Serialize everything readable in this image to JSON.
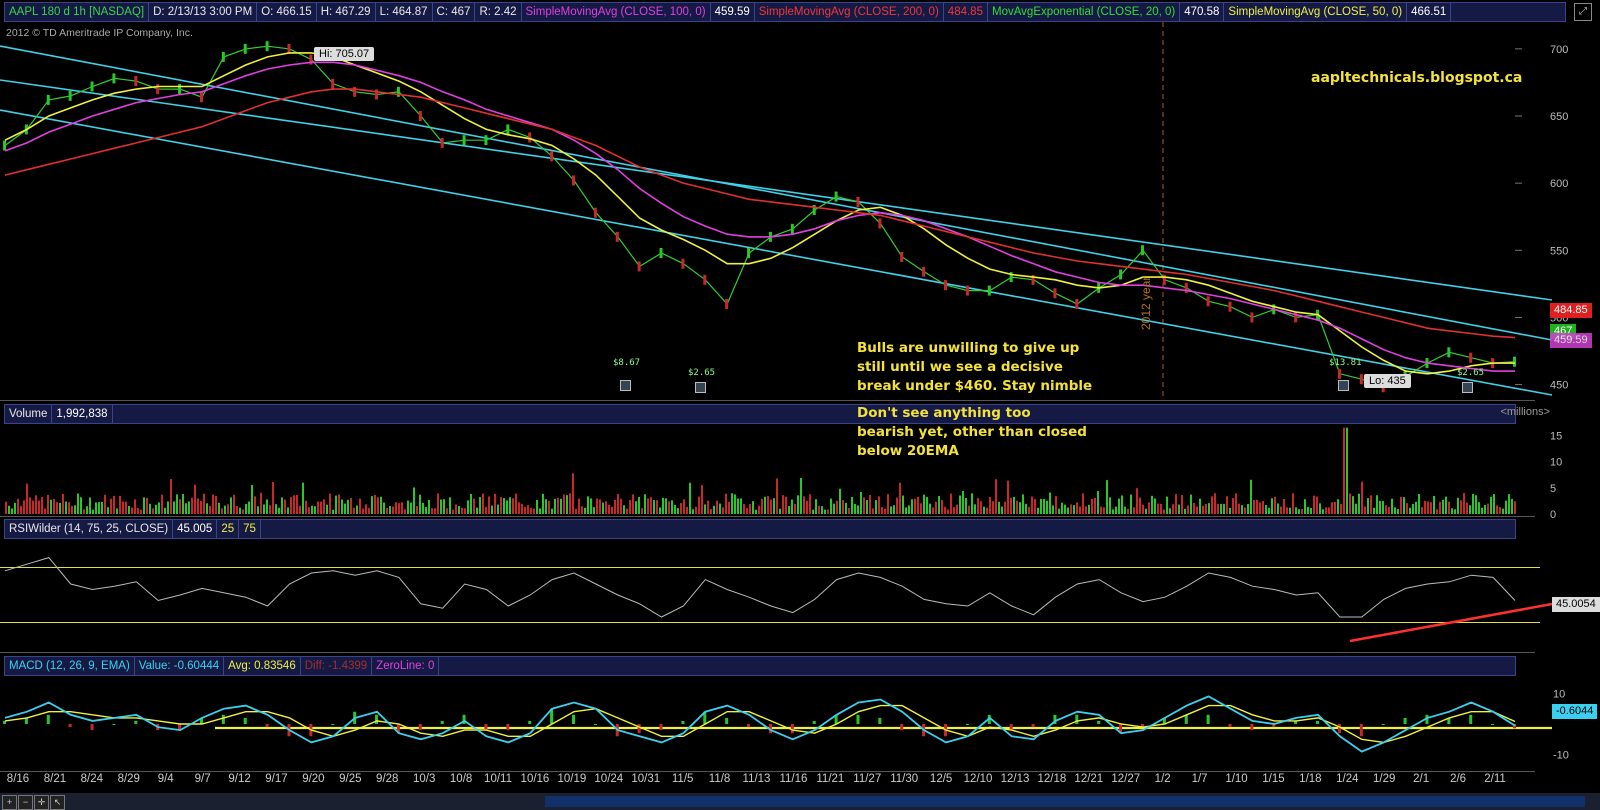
{
  "header": {
    "symbol": "AAPL 180 d 1h [NASDAQ]",
    "date": "D: 2/13/13 3:00 PM",
    "open": "O: 466.15",
    "high": "H: 467.29",
    "low": "L: 464.87",
    "close": "C: 467",
    "range": "R: 2.42",
    "studies": [
      {
        "label": "SimpleMovingAvg (CLOSE, 100, 0)",
        "value": "459.59",
        "color": "#e040e0"
      },
      {
        "label": "SimpleMovingAvg (CLOSE, 200, 0)",
        "value": "484.85",
        "color": "#e03030"
      },
      {
        "label": "MovAvgExponential (CLOSE, 20, 0)",
        "value": "470.58",
        "color": "#33dd33"
      },
      {
        "label": "SimpleMovingAvg (CLOSE, 50, 0)",
        "value": "466.51",
        "color": "#f0f040"
      }
    ]
  },
  "copyright": "2012 © TD Ameritrade IP Company, Inc.",
  "annotations": {
    "blog": "aapltechnicals.blogspot.ca",
    "bulls": "Bulls are unwilling to give up still until we see a decisive break under $460.  Stay nimble",
    "bearish": "Don't see anything too bearish yet, other than closed below 20EMA"
  },
  "callouts": {
    "hi": "Hi: 705.07",
    "lo": "Lo: 435",
    "year": "2012 year"
  },
  "events": [
    "$8.67",
    "$2.65",
    "$13.81",
    "$2.65"
  ],
  "price_tags": {
    "sma200": "484.85",
    "close": "467",
    "sma100": "459.59"
  },
  "volume": {
    "label": "Volume",
    "value": "1,992,838",
    "unit": "<millions>"
  },
  "rsi": {
    "label": "RSIWilder (14, 75, 25, CLOSE)",
    "value": "45.005",
    "ob": "25",
    "os": "75",
    "tag": "45.0054"
  },
  "macd": {
    "label": "MACD (12, 26, 9, EMA)",
    "value": "Value: -0.60444",
    "avg": "Avg: 0.83546",
    "diff": "Diff: -1.4399",
    "zero": "ZeroLine: 0",
    "tag": "-0.6044"
  },
  "chart_data": {
    "type": "line",
    "title": "AAPL 180 d 1h [NASDAQ]",
    "x_tick_labels": [
      "8/16",
      "8/21",
      "8/24",
      "8/29",
      "9/4",
      "9/7",
      "9/12",
      "9/17",
      "9/20",
      "9/25",
      "9/28",
      "10/3",
      "10/8",
      "10/11",
      "10/16",
      "10/19",
      "10/24",
      "10/31",
      "11/5",
      "11/8",
      "11/13",
      "11/16",
      "11/21",
      "11/27",
      "11/30",
      "12/5",
      "12/10",
      "12/13",
      "12/18",
      "12/21",
      "12/27",
      "1/2",
      "1/7",
      "1/10",
      "1/15",
      "1/18",
      "1/24",
      "1/29",
      "2/1",
      "2/6",
      "2/11"
    ],
    "price_axis": {
      "ticks": [
        450,
        500,
        550,
        600,
        650,
        700
      ],
      "ylim": [
        440,
        720
      ]
    },
    "series": [
      {
        "name": "Close",
        "color": "#33cc33",
        "values": [
          628,
          640,
          662,
          665,
          672,
          678,
          676,
          670,
          670,
          664,
          694,
          700,
          702,
          700,
          692,
          674,
          668,
          666,
          668,
          650,
          630,
          632,
          632,
          640,
          634,
          620,
          602,
          578,
          560,
          538,
          548,
          540,
          528,
          510,
          548,
          560,
          566,
          580,
          590,
          586,
          570,
          545,
          534,
          524,
          520,
          520,
          530,
          528,
          518,
          510,
          522,
          532,
          550,
          528,
          522,
          512,
          508,
          500,
          506,
          500,
          502,
          458,
          454,
          448,
          456,
          466,
          474,
          470,
          466,
          467
        ]
      },
      {
        "name": "SimpleMovingAvg (CLOSE, 50, 0)",
        "color": "#f0f040",
        "values": [
          632,
          640,
          650,
          656,
          662,
          667,
          670,
          672,
          672,
          672,
          680,
          688,
          694,
          697,
          697,
          694,
          688,
          682,
          676,
          668,
          658,
          648,
          640,
          636,
          633,
          628,
          618,
          606,
          590,
          574,
          565,
          558,
          550,
          540,
          540,
          544,
          552,
          562,
          572,
          580,
          582,
          576,
          566,
          554,
          544,
          536,
          532,
          530,
          528,
          524,
          522,
          524,
          530,
          530,
          528,
          524,
          518,
          512,
          508,
          504,
          502,
          490,
          478,
          468,
          460,
          458,
          460,
          464,
          466,
          466
        ]
      },
      {
        "name": "SimpleMovingAvg (CLOSE, 100, 0)",
        "color": "#e040e0",
        "values": [
          624,
          630,
          638,
          644,
          650,
          655,
          660,
          663,
          666,
          668,
          674,
          680,
          685,
          688,
          690,
          690,
          688,
          684,
          680,
          675,
          668,
          662,
          655,
          650,
          645,
          640,
          632,
          622,
          610,
          596,
          585,
          575,
          568,
          562,
          560,
          560,
          562,
          566,
          572,
          576,
          578,
          576,
          572,
          566,
          560,
          553,
          546,
          540,
          534,
          530,
          526,
          524,
          524,
          522,
          520,
          517,
          514,
          510,
          506,
          502,
          498,
          492,
          484,
          476,
          470,
          466,
          464,
          462,
          460,
          460
        ]
      },
      {
        "name": "SimpleMovingAvg (CLOSE, 200, 0)",
        "color": "#e03030",
        "values": [
          606,
          610,
          614,
          618,
          622,
          626,
          630,
          634,
          638,
          642,
          648,
          654,
          660,
          664,
          668,
          670,
          670,
          668,
          666,
          664,
          660,
          656,
          652,
          648,
          644,
          640,
          634,
          628,
          620,
          612,
          606,
          600,
          596,
          592,
          588,
          586,
          584,
          582,
          580,
          578,
          576,
          572,
          568,
          564,
          560,
          556,
          552,
          548,
          545,
          542,
          540,
          538,
          536,
          534,
          532,
          529,
          526,
          523,
          520,
          516,
          512,
          508,
          504,
          500,
          496,
          492,
          490,
          488,
          486,
          485
        ]
      }
    ],
    "volume_axis": {
      "ticks": [
        0,
        5,
        10,
        15
      ],
      "unit": "millions"
    },
    "rsi_axis": {
      "ticks": [
        25,
        75
      ]
    },
    "rsi_values": [
      72,
      78,
      84,
      60,
      55,
      58,
      62,
      45,
      50,
      56,
      52,
      48,
      40,
      60,
      70,
      72,
      68,
      72,
      66,
      42,
      38,
      60,
      55,
      40,
      50,
      64,
      70,
      60,
      50,
      42,
      30,
      40,
      64,
      55,
      48,
      40,
      34,
      46,
      64,
      70,
      66,
      58,
      46,
      42,
      40,
      52,
      40,
      32,
      48,
      60,
      64,
      52,
      44,
      48,
      58,
      70,
      66,
      58,
      55,
      50,
      52,
      30,
      30,
      46,
      56,
      60,
      62,
      68,
      66,
      45
    ],
    "macd_axis": {
      "ticks": [
        -10,
        10
      ]
    },
    "macd_values": [
      2,
      4,
      7,
      3,
      1,
      2,
      3,
      -1,
      -2,
      2,
      5,
      6,
      3,
      -2,
      -6,
      -4,
      2,
      4,
      -3,
      -5,
      -3,
      1,
      -4,
      -6,
      -3,
      5,
      7,
      5,
      -2,
      -4,
      -6,
      -3,
      4,
      6,
      3,
      -2,
      -5,
      -2,
      3,
      7,
      8,
      4,
      -2,
      -6,
      -4,
      2,
      -4,
      -5,
      1,
      4,
      3,
      -3,
      -2,
      2,
      6,
      9,
      5,
      1,
      0,
      2,
      3,
      -4,
      -9,
      -6,
      -2,
      2,
      4,
      7,
      4,
      -0.6
    ],
    "macd_avg_values": [
      1,
      2,
      4,
      4,
      3,
      2,
      2,
      1,
      0,
      0,
      2,
      4,
      4,
      2,
      -2,
      -4,
      -2,
      1,
      0,
      -3,
      -4,
      -2,
      -2,
      -4,
      -4,
      0,
      4,
      5,
      2,
      -1,
      -4,
      -4,
      0,
      4,
      4,
      1,
      -2,
      -3,
      0,
      4,
      6,
      6,
      2,
      -2,
      -4,
      -1,
      -2,
      -4,
      -2,
      1,
      2,
      0,
      -1,
      0,
      3,
      6,
      6,
      3,
      1,
      1,
      2,
      -1,
      -5,
      -6,
      -4,
      -1,
      2,
      4,
      4,
      0.8
    ]
  }
}
